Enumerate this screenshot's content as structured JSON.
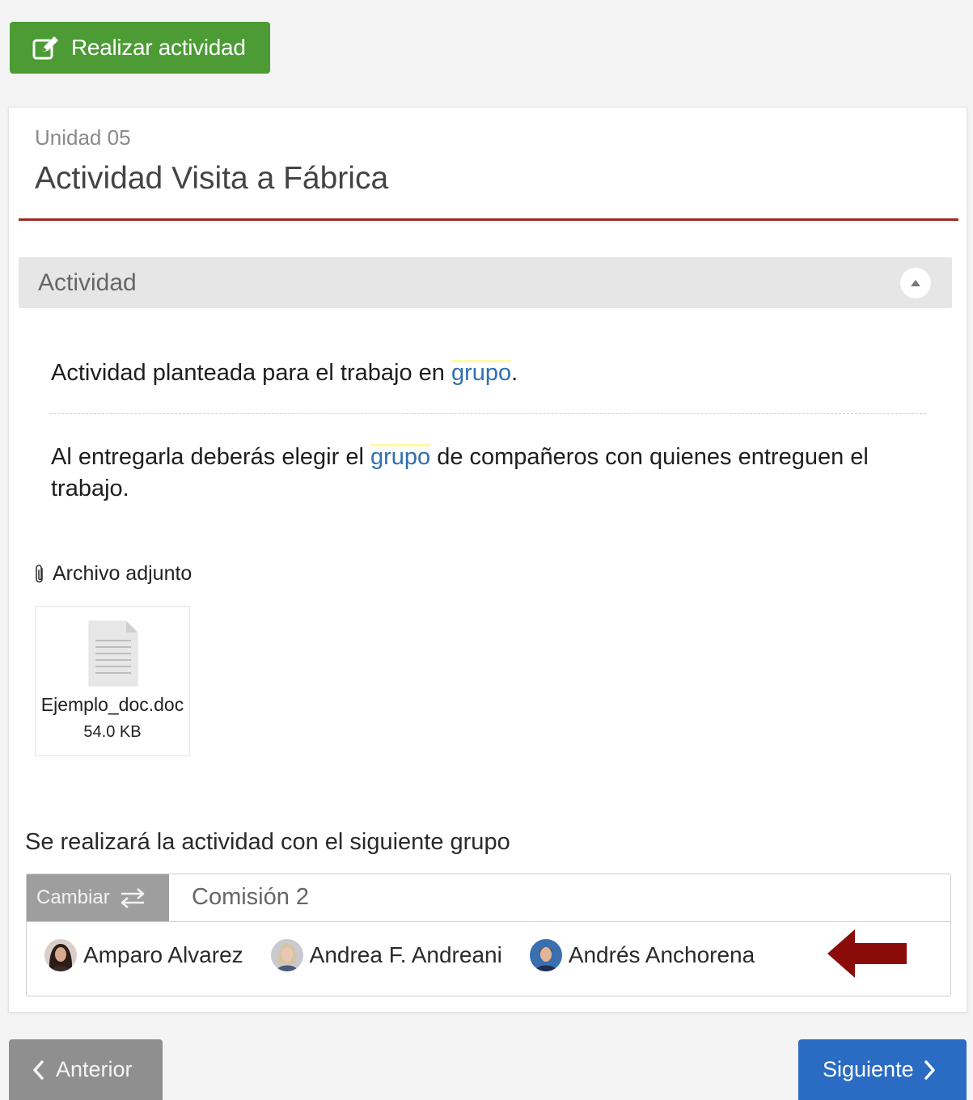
{
  "toolbar": {
    "realizar_label": "Realizar actividad",
    "realizar_icon": "edit-icon",
    "accent_color": "#4c9b35"
  },
  "header": {
    "unit": "Unidad 05",
    "title": "Actividad Visita a Fábrica",
    "rule_color": "#9b2a26"
  },
  "section": {
    "label": "Actividad",
    "toggle_icon": "caret-up-icon"
  },
  "content": {
    "p1_before": "Actividad planteada para el trabajo en ",
    "p1_link": "grupo",
    "p1_after": ".",
    "p2_before": "Al entregarla deberás elegir el ",
    "p2_link": "grupo",
    "p2_after": " de compañeros con quienes entreguen el trabajo."
  },
  "attachment": {
    "label": "Archivo adjunto",
    "icon": "paperclip-icon",
    "file_name": "Ejemplo_doc.doc",
    "file_size": "54.0 KB",
    "file_icon": "document-icon"
  },
  "group": {
    "lead": "Se realizará la actividad con el siguiente grupo",
    "change_label": "Cambiar",
    "change_icon": "swap-icon",
    "name": "Comisión 2",
    "members": [
      {
        "name": "Amparo Alvarez"
      },
      {
        "name": "Andrea F. Andreani"
      },
      {
        "name": "Andrés Anchorena"
      }
    ],
    "pointer_icon": "arrow-left-icon",
    "pointer_color": "#8b0a0a"
  },
  "nav": {
    "prev_label": "Anterior",
    "next_label": "Siguiente",
    "prev_color": "#8f8f8f",
    "next_color": "#2a6bc3"
  }
}
